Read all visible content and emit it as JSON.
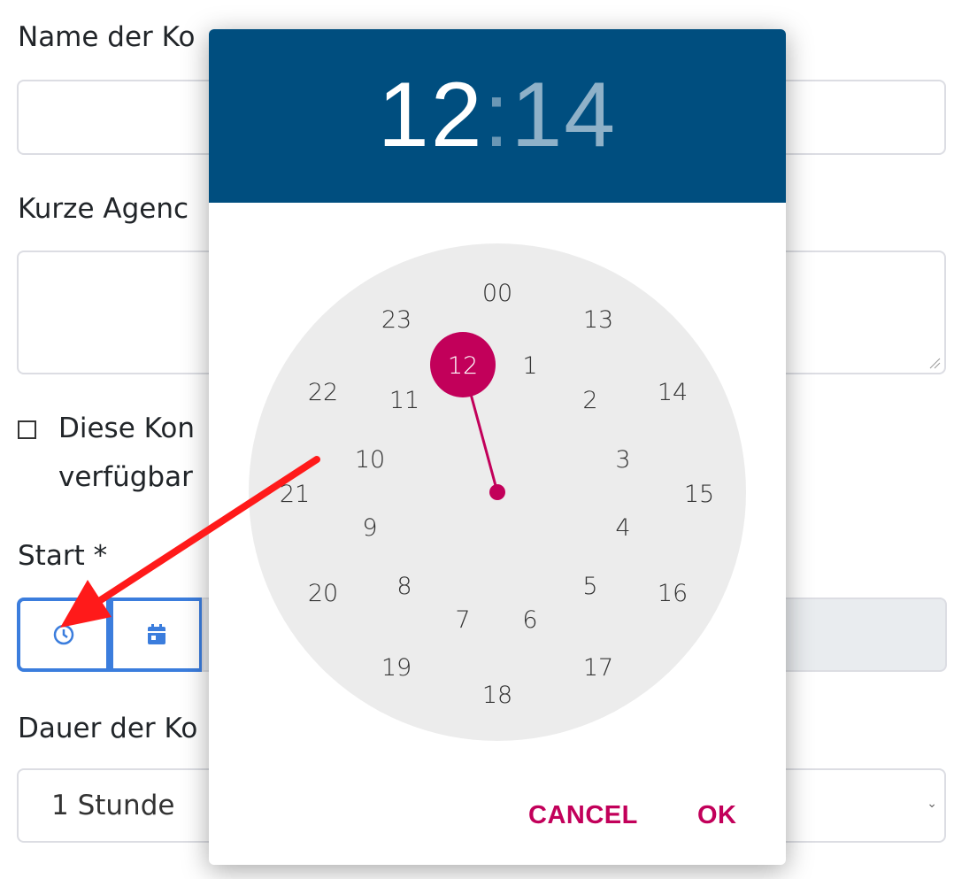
{
  "form": {
    "label_name": "Name der Konferenz *",
    "label_agenda": "Kurze Agenda für die Sitzungsteilnehmer",
    "checkbox_line1": "Diese Konferenz ist für alle verfügbar",
    "checkbox_line2": "verfügbar",
    "label_start": "Start *",
    "label_duration": "Dauer der Konferenz",
    "duration_value": "1 Stunde"
  },
  "picker": {
    "hour": "12",
    "separator": ":",
    "minute": "14",
    "selected_hour": "12",
    "outer_ring": [
      "00",
      "13",
      "14",
      "15",
      "16",
      "17",
      "18",
      "19",
      "20",
      "21",
      "22",
      "23"
    ],
    "inner_ring": [
      "12",
      "1",
      "2",
      "3",
      "4",
      "5",
      "6",
      "7",
      "8",
      "9",
      "10",
      "11"
    ],
    "cancel_label": "CANCEL",
    "ok_label": "OK"
  },
  "colors": {
    "header_bg": "#004e7f",
    "accent": "#c2005a",
    "dial_bg": "#ececec",
    "input_group_border": "#3b7ddd",
    "annotation_arrow": "#ff1a1a"
  },
  "icons": {
    "time_button": "clock-icon",
    "date_button": "calendar-icon",
    "select_caret": "chevron-down-icon"
  }
}
